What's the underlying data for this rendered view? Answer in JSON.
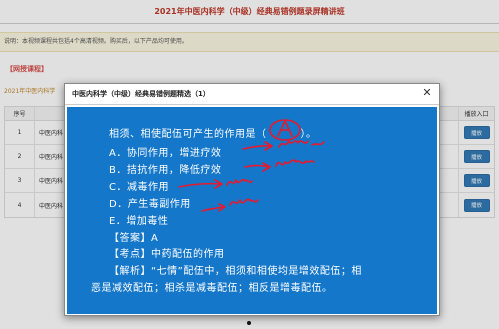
{
  "page": {
    "title": "2021年中医内科学（中级）经典易错例题录屏精讲班",
    "notice": "说明：本视频课程共包括4个高清视频。购买后，以下产品均可使用。",
    "section_heading": "【网授课程】",
    "course_subtitle": "2021年中医内科学"
  },
  "table": {
    "headers": {
      "no": "序号",
      "name": "",
      "action": "播放入口"
    },
    "rows": [
      {
        "no": "1",
        "name": "中医内科",
        "action": "播放"
      },
      {
        "no": "2",
        "name": "中医内科",
        "action": "播放"
      },
      {
        "no": "3",
        "name": "中医内科",
        "action": "播放"
      },
      {
        "no": "4",
        "name": "中医内科",
        "action": "播放"
      }
    ]
  },
  "modal": {
    "title": "中医内科学（中级）经典易错例题精选（1）",
    "close_icon": "close-icon"
  },
  "slide": {
    "question_prefix": "相须、相使配伍可产生的作用是（",
    "question_suffix": "）。",
    "options": [
      "A．协同作用，增进疗效",
      "B．拮抗作用，降低疗效",
      "C．减毒作用",
      "D．产生毒副作用",
      "E．增加毒性"
    ],
    "answer": "【答案】A",
    "key_point": "【考点】中药配伍的作用",
    "analysis_1": "【解析】“七情”配伍中，相须和相使均是增效配伍；相",
    "analysis_2": "恶是减效配伍；相杀是减毒配伍；相反是增毒配伍。",
    "background_color": "#1577c9",
    "annotation_color": "#e8192c"
  }
}
